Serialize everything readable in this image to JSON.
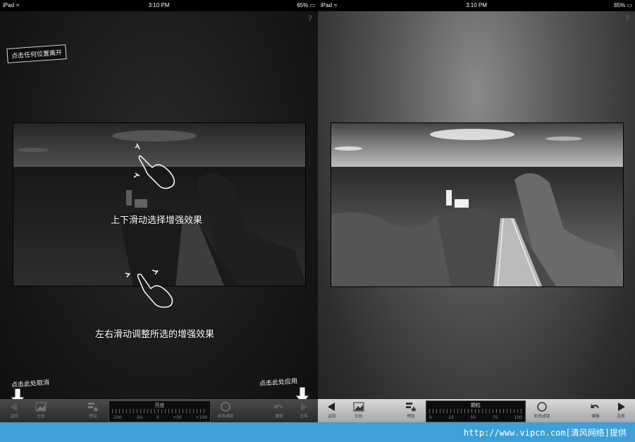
{
  "status_bar": {
    "device": "iPad",
    "time": "3:10 PM",
    "battery": "65%"
  },
  "help_icon": "?",
  "leave_label": "点击任何位置离开",
  "hints": {
    "vertical": "上下滑动选择增强效果",
    "horizontal": "左右滑动调整所选的增强效果"
  },
  "corner_hints": {
    "cancel": "点击此处取消",
    "apply": "点击此处应用"
  },
  "left_toolbar": {
    "back": "返回",
    "compare": "比较",
    "presets": "预设",
    "slider_name": "亮度",
    "ticks": [
      "-100",
      "-50",
      "0",
      "+50",
      "+100"
    ],
    "filter": "彩色滤镜",
    "undo": "撤销",
    "apply": "应用"
  },
  "right_toolbar": {
    "back": "返回",
    "compare": "比较",
    "presets": "预设",
    "slider_name": "颗粒",
    "ticks": [
      "0",
      "25",
      "50",
      "75",
      "100"
    ],
    "filter": "彩色滤镜",
    "edit": "编辑",
    "apply": "应用"
  },
  "watermark": "http://www.vipcn.com[清风网络]提供",
  "colors": {
    "watermark_bar": "#3da0d6"
  },
  "icons": [
    "wifi-icon",
    "battery-icon",
    "hand-icon",
    "back-arrow-icon",
    "forward-arrow-icon",
    "image-icon",
    "presets-icon",
    "circle-filter-icon",
    "undo-icon"
  ]
}
